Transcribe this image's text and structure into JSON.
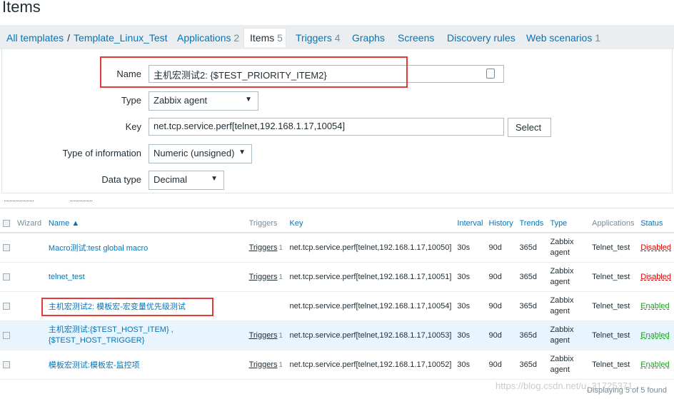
{
  "page": {
    "title": "Items"
  },
  "nav": {
    "all_templates": "All templates",
    "separator": "/",
    "template": "Template_Linux_Test",
    "tabs": [
      {
        "label": "Applications",
        "count": "2"
      },
      {
        "label": "Items",
        "count": "5"
      },
      {
        "label": "Triggers",
        "count": "4"
      },
      {
        "label": "Graphs",
        "count": ""
      },
      {
        "label": "Screens",
        "count": ""
      },
      {
        "label": "Discovery rules",
        "count": ""
      },
      {
        "label": "Web scenarios",
        "count": "1"
      }
    ]
  },
  "form": {
    "name_label": "Name",
    "name_value": "主机宏测试2: {$TEST_PRIORITY_ITEM2}",
    "type_label": "Type",
    "type_value": "Zabbix agent",
    "key_label": "Key",
    "key_value": "net.tcp.service.perf[telnet,192.168.1.17,10054]",
    "select_button": "Select",
    "info_label": "Type of information",
    "info_value": "Numeric (unsigned)",
    "datatype_label": "Data type",
    "datatype_value": "Decimal",
    "dropdown_arrow": "▼"
  },
  "table": {
    "headers": {
      "wizard": "Wizard",
      "name": "Name ▲",
      "triggers": "Triggers",
      "key": "Key",
      "interval": "Interval",
      "history": "History",
      "trends": "Trends",
      "type": "Type",
      "applications": "Applications",
      "status": "Status"
    },
    "rows": [
      {
        "name": "Macro测试:test global macro",
        "triggers": "Triggers",
        "trigger_count": "1",
        "key": "net.tcp.service.perf[telnet,192.168.1.17,10050]",
        "interval": "30s",
        "history": "90d",
        "trends": "365d",
        "type": "Zabbix agent",
        "application": "Telnet_test",
        "status": "Disabled"
      },
      {
        "name": "telnet_test",
        "triggers": "Triggers",
        "trigger_count": "1",
        "key": "net.tcp.service.perf[telnet,192.168.1.17,10051]",
        "interval": "30s",
        "history": "90d",
        "trends": "365d",
        "type": "Zabbix agent",
        "application": "Telnet_test",
        "status": "Disabled"
      },
      {
        "name": "主机宏测试2: 模板宏-宏变量优先级测试",
        "triggers": "",
        "trigger_count": "",
        "key": "net.tcp.service.perf[telnet,192.168.1.17,10054]",
        "interval": "30s",
        "history": "90d",
        "trends": "365d",
        "type": "Zabbix agent",
        "application": "Telnet_test",
        "status": "Enabled"
      },
      {
        "name": "主机宏测试:{$TEST_HOST_ITEM} , {$TEST_HOST_TRIGGER}",
        "triggers": "Triggers",
        "trigger_count": "1",
        "key": "net.tcp.service.perf[telnet,192.168.1.17,10053]",
        "interval": "30s",
        "history": "90d",
        "trends": "365d",
        "type": "Zabbix agent",
        "application": "Telnet_test",
        "status": "Enabled"
      },
      {
        "name": "模板宏测试:模板宏-监控项",
        "triggers": "Triggers",
        "trigger_count": "1",
        "key": "net.tcp.service.perf[telnet,192.168.1.17,10052]",
        "interval": "30s",
        "history": "90d",
        "trends": "365d",
        "type": "Zabbix agent",
        "application": "Telnet_test",
        "status": "Enabled"
      }
    ]
  },
  "footer": {
    "displaying": "Displaying 5 of 5 found"
  },
  "watermark": "https://blog.csdn.net/u_31725371",
  "colors": {
    "link": "#0275b8",
    "disabled": "#dc0000",
    "enabled": "#1a9e1a",
    "highlight": "#e53935",
    "selected_row": "#e8f5ff"
  }
}
